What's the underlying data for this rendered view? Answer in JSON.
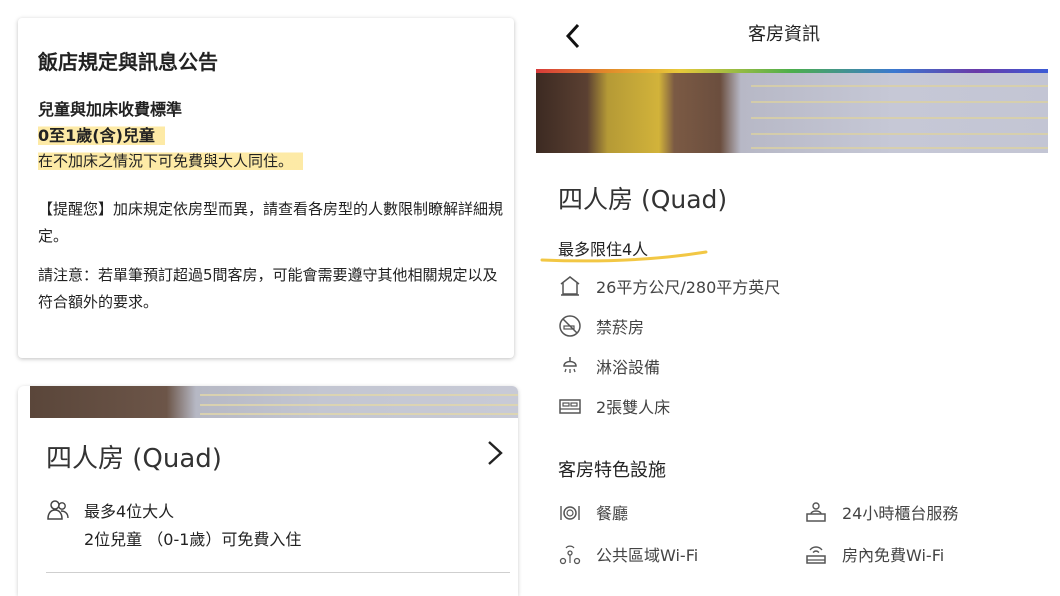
{
  "policy": {
    "title": "飯店規定與訊息公告",
    "subtitle": "兒童與加床收費標準",
    "age": "0至1歲(含)兒童",
    "free_stay": "在不加床之情況下可免費與大人同住。",
    "reminder": "【提醒您】加床規定依房型而異，請查看各房型的人數限制瞭解詳細規定。",
    "note": "請注意：若單筆預訂超過5間客房，可能會需要遵守其他相關規定以及符合額外的要求。"
  },
  "left_room": {
    "name": "四人房 (Quad)",
    "max_adults": "最多4位大人",
    "children_free": "2位兒童 （0-1歲）可免費入住"
  },
  "right": {
    "header_title": "客房資訊",
    "room_name": "四人房 (Quad)",
    "max_occupancy": "最多限住4人",
    "amenities": [
      {
        "icon": "house-icon",
        "label": "26平方公尺/280平方英尺"
      },
      {
        "icon": "no-smoking-icon",
        "label": "禁菸房"
      },
      {
        "icon": "shower-icon",
        "label": "淋浴設備"
      },
      {
        "icon": "bed-icon",
        "label": "2張雙人床"
      }
    ],
    "features_title": "客房特色設施",
    "features": [
      {
        "icon": "restaurant-icon",
        "label": "餐廳"
      },
      {
        "icon": "front-desk-icon",
        "label": "24小時櫃台服務"
      },
      {
        "icon": "public-wifi-icon",
        "label": "公共區域Wi-Fi"
      },
      {
        "icon": "room-wifi-icon",
        "label": "房內免費Wi-Fi"
      }
    ]
  },
  "colors": {
    "highlight": "#fde696",
    "highlight_underline": "#f2c744"
  }
}
